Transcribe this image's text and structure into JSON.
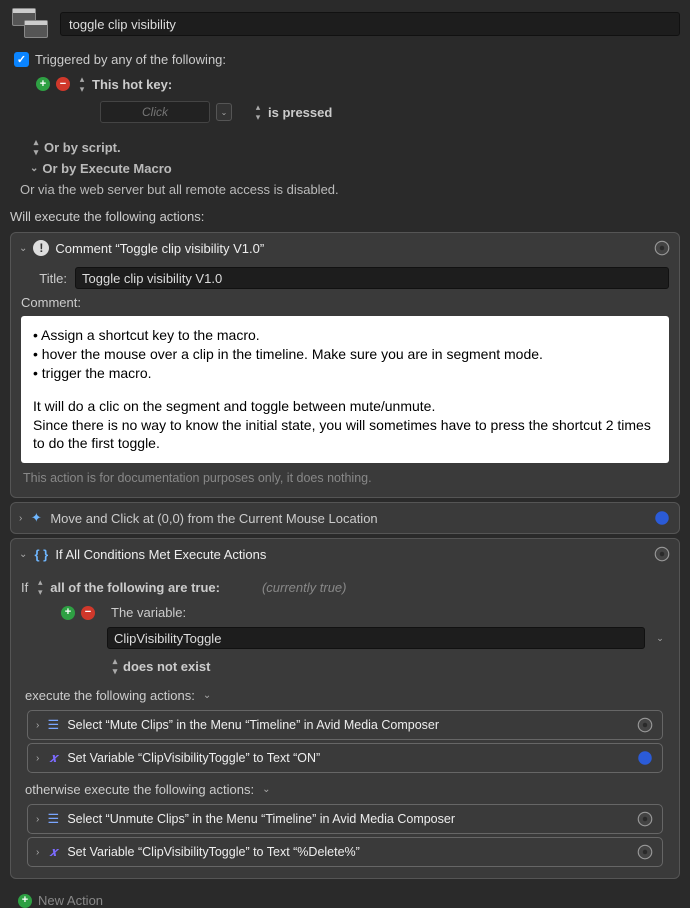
{
  "header": {
    "macro_name": "toggle clip visibility"
  },
  "triggers": {
    "checkbox_label": "Triggered by any of the following:",
    "hotkey_label": "This hot key:",
    "hotkey_placeholder": "Click",
    "is_pressed": "is pressed",
    "or_script": "Or by script.",
    "or_execute_macro": "Or by Execute Macro",
    "or_web": "Or via the web server but all remote access is disabled."
  },
  "exec_label": "Will execute the following actions:",
  "comment_action": {
    "header": "Comment “Toggle clip visibility V1.0”",
    "title_label": "Title:",
    "title_value": "Toggle clip visibility V1.0",
    "comment_label": "Comment:",
    "body_line1": "• Assign a shortcut key to the macro.",
    "body_line2": "• hover the mouse over a clip in the timeline. Make sure you are in segment mode.",
    "body_line3": "• trigger the macro.",
    "body_line4": "It will do a clic on the segment and toggle between mute/unmute.",
    "body_line5": "Since there is no way to know the initial state, you will sometimes have to press the shortcut 2 times to do the first toggle.",
    "doc_note": "This action is for documentation purposes only, it does nothing."
  },
  "move_click": {
    "label": "Move and Click at (0,0) from the Current Mouse Location"
  },
  "if_action": {
    "header": "If All Conditions Met Execute Actions",
    "if_word": "If",
    "all_true": "all of the following are true:",
    "currently": "(currently true)",
    "the_variable": "The variable:",
    "var_name": "ClipVisibilityToggle",
    "does_not_exist": "does not exist",
    "exec_label": "execute the following actions:",
    "then1": "Select “Mute Clips” in the Menu “Timeline” in Avid Media Composer",
    "then2": "Set Variable “ClipVisibilityToggle” to Text “ON”",
    "otherwise_label": "otherwise execute the following actions:",
    "else1": "Select “Unmute Clips” in the Menu “Timeline” in Avid Media Composer",
    "else2": "Set Variable “ClipVisibilityToggle” to Text “%Delete%”"
  },
  "new_action": "New Action"
}
